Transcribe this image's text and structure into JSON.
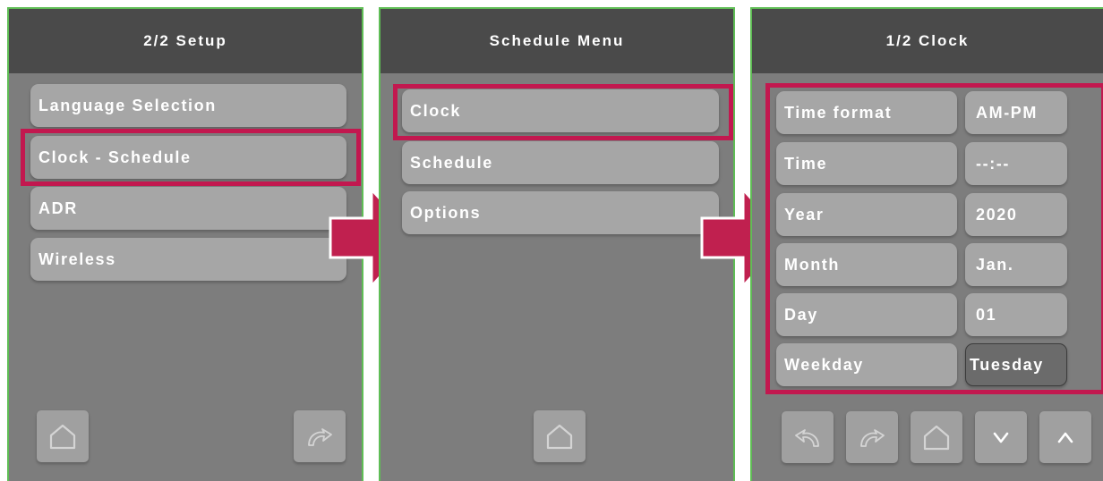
{
  "colors": {
    "screen_bg": "#7d7d7d",
    "header_bg": "#4a4a4a",
    "item_bg": "#a6a6a6",
    "highlight": "#c2184f",
    "frame_border": "#5fbd55"
  },
  "screen1": {
    "title": "2/2 Setup",
    "items": [
      {
        "label": "Language Selection"
      },
      {
        "label": "Clock - Schedule",
        "highlighted": true
      },
      {
        "label": "ADR"
      },
      {
        "label": "Wireless"
      }
    ],
    "nav": [
      "home-icon",
      "forward-icon"
    ]
  },
  "screen2": {
    "title": "Schedule Menu",
    "items": [
      {
        "label": "Clock",
        "highlighted": true
      },
      {
        "label": "Schedule"
      },
      {
        "label": "Options"
      }
    ],
    "nav": [
      "home-icon"
    ]
  },
  "screen3": {
    "title": "1/2 Clock",
    "rows": [
      {
        "label": "Time format",
        "value": "AM-PM"
      },
      {
        "label": "Time",
        "value": "--:--"
      },
      {
        "label": "Year",
        "value": "2020"
      },
      {
        "label": "Month",
        "value": "Jan."
      },
      {
        "label": "Day",
        "value": "01"
      },
      {
        "label": "Weekday",
        "value": "Tuesday",
        "selected": true
      }
    ],
    "nav": [
      "back-icon",
      "forward-icon",
      "home-icon",
      "down-chevron-icon",
      "up-chevron-icon"
    ]
  }
}
